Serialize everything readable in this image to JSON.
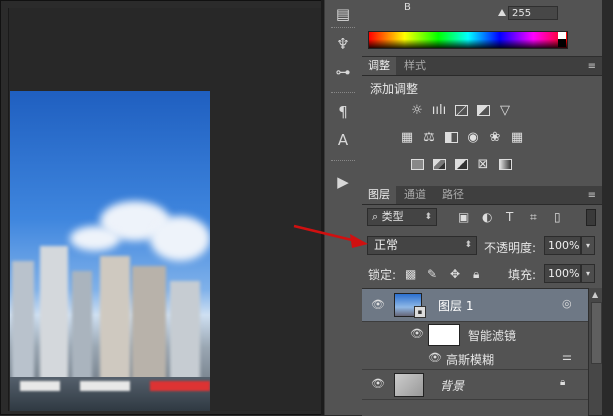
{
  "color_panel": {
    "channel_label": "B",
    "channel_value": "255",
    "spectrum_colors": [
      "#ff0000",
      "#ffff00",
      "#00ff00",
      "#00ffff",
      "#0000ff",
      "#ff00ff"
    ]
  },
  "adjustments_panel": {
    "tabs": [
      {
        "label": "调整",
        "active": true
      },
      {
        "label": "样式",
        "active": false
      }
    ],
    "title": "添加调整",
    "icons_row1": [
      "brightness-contrast-icon",
      "levels-icon",
      "curves-icon",
      "exposure-icon",
      "vibrance-icon"
    ],
    "icons_row2": [
      "hue-saturation-icon",
      "color-balance-icon",
      "black-white-icon",
      "photo-filter-icon",
      "channel-mixer-icon",
      "color-lookup-icon"
    ],
    "icons_row3": [
      "invert-icon",
      "posterize-icon",
      "threshold-icon",
      "selective-color-icon",
      "gradient-map-icon"
    ]
  },
  "layers_panel": {
    "tabs": [
      {
        "label": "图层",
        "active": true
      },
      {
        "label": "通道",
        "active": false
      },
      {
        "label": "路径",
        "active": false
      }
    ],
    "filter_kind": "类型",
    "filter_search_icon": "search-icon",
    "blend_mode": "正常",
    "opacity_label": "不透明度:",
    "opacity_value": "100%",
    "lock_label": "锁定:",
    "fill_label": "填充:",
    "fill_value": "100%",
    "layers": [
      {
        "name": "图层 1",
        "selected": true,
        "type": "smart-object"
      },
      {
        "name": "智能滤镜",
        "selected": false,
        "type": "smart-filter-mask"
      },
      {
        "name": "高斯模糊",
        "selected": false,
        "type": "filter"
      },
      {
        "name": "背景",
        "selected": false,
        "type": "background",
        "locked": true
      }
    ]
  },
  "annotation": {
    "color": "#d01010"
  },
  "accent_colors": {
    "selected_layer": "#6e7885",
    "panel_bg": "#535353",
    "canvas_bg": "#282828"
  }
}
